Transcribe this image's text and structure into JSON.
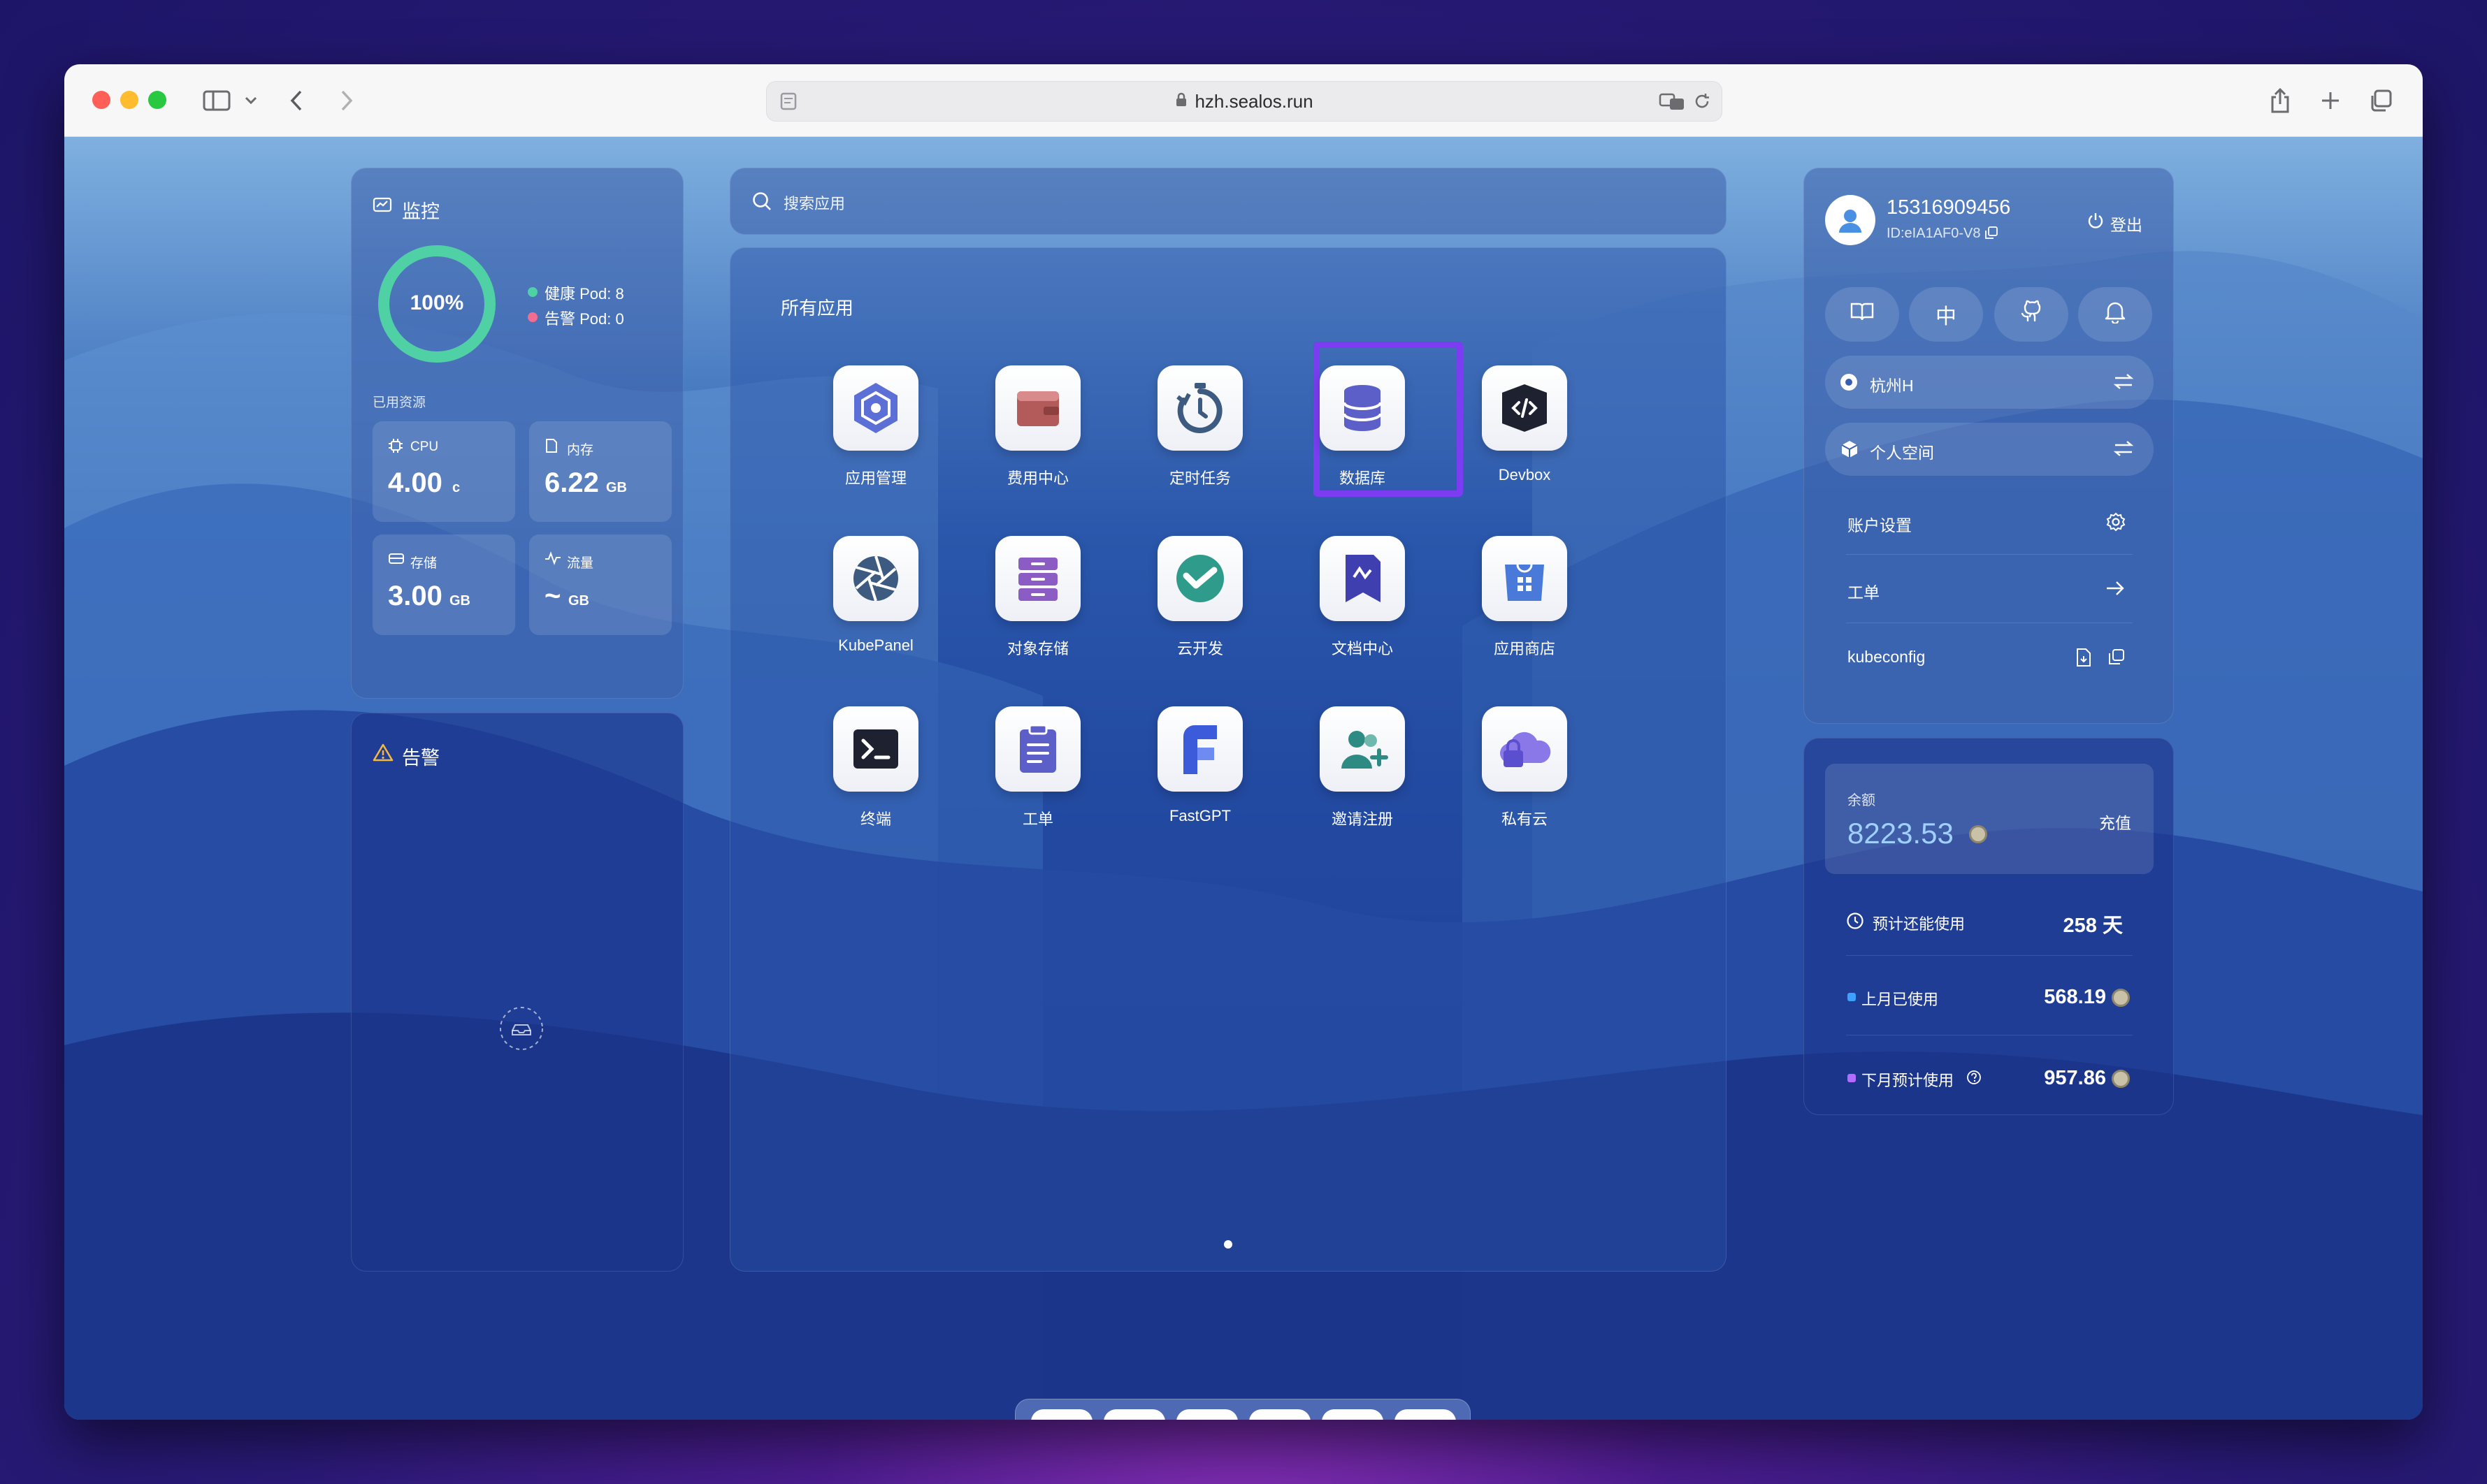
{
  "browser": {
    "url": "hzh.sealos.run"
  },
  "monitor": {
    "title": "监控",
    "health_percent": "100%",
    "health_value": 1.0,
    "healthy_pods": "健康 Pod: 8",
    "alert_pods": "告警 Pod: 0",
    "used_resources_label": "已用资源",
    "cpu": {
      "label": "CPU",
      "value": "4.00",
      "unit": "c"
    },
    "memory": {
      "label": "内存",
      "value": "6.22",
      "unit": "GB"
    },
    "storage": {
      "label": "存储",
      "value": "3.00",
      "unit": "GB"
    },
    "traffic": {
      "label": "流量",
      "value": "~",
      "unit": "GB"
    }
  },
  "alerts": {
    "title": "告警"
  },
  "search": {
    "placeholder": "搜索应用"
  },
  "apps": {
    "title": "所有应用",
    "items": [
      {
        "name": "应用管理",
        "icon": "app-manage-icon"
      },
      {
        "name": "费用中心",
        "icon": "wallet-icon"
      },
      {
        "name": "定时任务",
        "icon": "timer-icon"
      },
      {
        "name": "数据库",
        "icon": "database-icon",
        "selected": true
      },
      {
        "name": "Devbox",
        "icon": "devbox-icon"
      },
      {
        "name": "KubePanel",
        "icon": "kubepanel-icon"
      },
      {
        "name": "对象存储",
        "icon": "object-storage-icon"
      },
      {
        "name": "云开发",
        "icon": "cloud-dev-icon"
      },
      {
        "name": "文档中心",
        "icon": "docs-icon"
      },
      {
        "name": "应用商店",
        "icon": "app-store-icon"
      },
      {
        "name": "终端",
        "icon": "terminal-icon"
      },
      {
        "name": "工单",
        "icon": "ticket-icon"
      },
      {
        "name": "FastGPT",
        "icon": "fastgpt-icon"
      },
      {
        "name": "邀请注册",
        "icon": "invite-icon"
      },
      {
        "name": "私有云",
        "icon": "private-cloud-icon"
      }
    ]
  },
  "user": {
    "phone": "15316909456",
    "id": "ID:eIA1AF0-V8",
    "logout": "登出",
    "lang": "中",
    "region": "杭州H",
    "workspace": "个人空间",
    "account_settings": "账户设置",
    "ticket": "工单",
    "kubeconfig": "kubeconfig"
  },
  "billing": {
    "balance_label": "余额",
    "balance": "8223.53",
    "recharge": "充值",
    "days_label": "预计还能使用",
    "days_value": "258 天",
    "last_month_label": "上月已使用",
    "last_month_value": "568.19",
    "next_month_label": "下月预计使用",
    "next_month_value": "957.86"
  },
  "colors": {
    "accent_green": "#4fd1a5",
    "alert_pink": "#f26d8f",
    "selection_purple": "#7b3cf2",
    "balance_blue": "#9fd0ff"
  }
}
